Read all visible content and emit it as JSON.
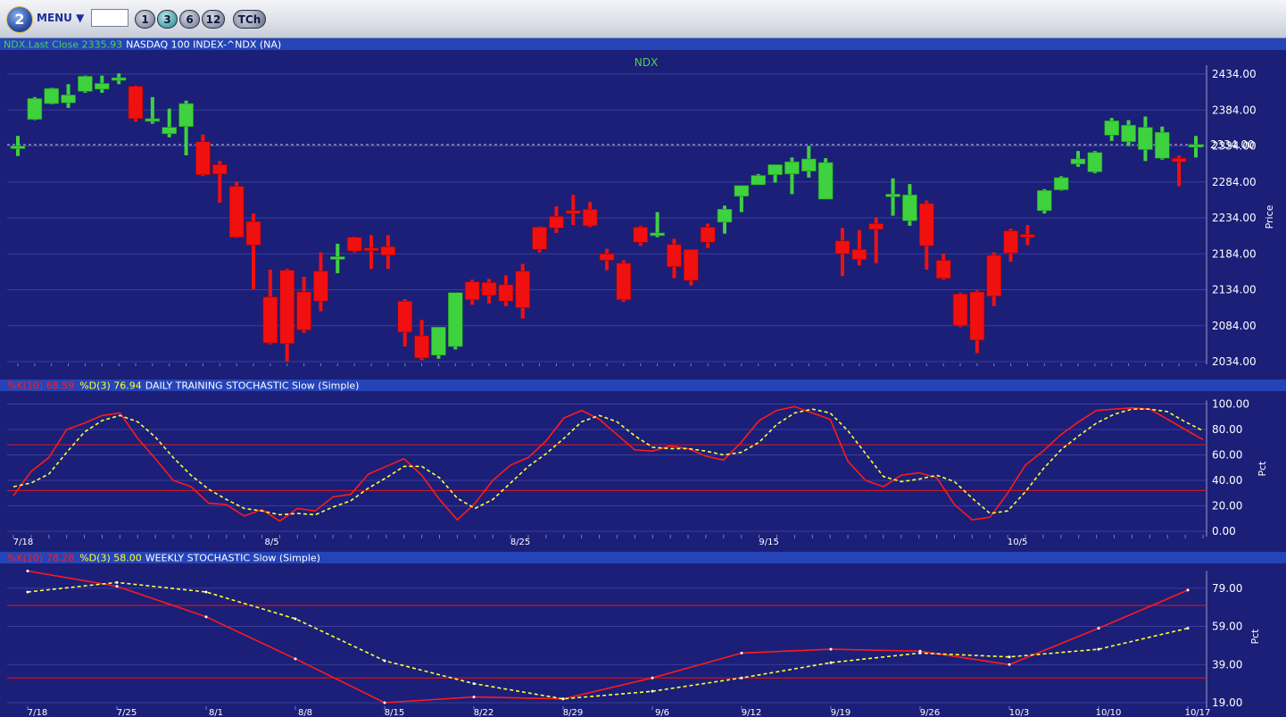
{
  "toolbar": {
    "menu_label": "MENU ▼",
    "symbol_input_value": "",
    "buttons": [
      "1",
      "3",
      "6",
      "12",
      "TCh"
    ],
    "active_button": "3"
  },
  "colors": {
    "panel_bg": "#1b1f78",
    "header_bar": "#2544b8",
    "up_candle": "#3ed23e",
    "down_candle": "#f01010",
    "k_line": "#ff1a1a",
    "d_line": "#ffff33",
    "grid": "#3a3f9a"
  },
  "chart_data": [
    {
      "type": "candlestick",
      "panel": "price",
      "header_symbol": "NDX.Last Close",
      "header_value": "2335.93",
      "header_desc": "NASDAQ 100 INDEX-^NDX (NA)",
      "title": "NDX",
      "ylabel": "Price",
      "ylim": [
        2034,
        2469
      ],
      "yticks": [
        2034,
        2084,
        2134,
        2184,
        2234,
        2284,
        2334,
        2384,
        2434
      ],
      "ytick_labels": [
        "2034.00",
        "2084.00",
        "2134.00",
        "2184.00",
        "2234.00",
        "2284.00",
        "2334.00",
        "2384.00",
        "2434.00"
      ],
      "last_close": 2335.93,
      "candles": [
        {
          "o": 2332,
          "h": 2348,
          "l": 2320,
          "c": 2334
        },
        {
          "o": 2371,
          "h": 2402,
          "l": 2370,
          "c": 2400
        },
        {
          "o": 2393,
          "h": 2415,
          "l": 2392,
          "c": 2414
        },
        {
          "o": 2394,
          "h": 2420,
          "l": 2387,
          "c": 2405
        },
        {
          "o": 2410,
          "h": 2432,
          "l": 2408,
          "c": 2431
        },
        {
          "o": 2413,
          "h": 2432,
          "l": 2408,
          "c": 2421
        },
        {
          "o": 2427,
          "h": 2435,
          "l": 2420,
          "c": 2429
        },
        {
          "o": 2417,
          "h": 2418,
          "l": 2368,
          "c": 2372
        },
        {
          "o": 2371,
          "h": 2402,
          "l": 2365,
          "c": 2372
        },
        {
          "o": 2351,
          "h": 2386,
          "l": 2346,
          "c": 2360
        },
        {
          "o": 2361,
          "h": 2397,
          "l": 2321,
          "c": 2393
        },
        {
          "o": 2340,
          "h": 2350,
          "l": 2292,
          "c": 2294
        },
        {
          "o": 2308,
          "h": 2313,
          "l": 2255,
          "c": 2295
        },
        {
          "o": 2278,
          "h": 2284,
          "l": 2206,
          "c": 2207
        },
        {
          "o": 2229,
          "h": 2240,
          "l": 2135,
          "c": 2196
        },
        {
          "o": 2124,
          "h": 2162,
          "l": 2058,
          "c": 2060
        },
        {
          "o": 2161,
          "h": 2163,
          "l": 2034,
          "c": 2059
        },
        {
          "o": 2131,
          "h": 2152,
          "l": 2074,
          "c": 2078
        },
        {
          "o": 2160,
          "h": 2186,
          "l": 2104,
          "c": 2118
        },
        {
          "o": 2180,
          "h": 2198,
          "l": 2157,
          "c": 2180
        },
        {
          "o": 2207,
          "h": 2208,
          "l": 2186,
          "c": 2188
        },
        {
          "o": 2192,
          "h": 2210,
          "l": 2163,
          "c": 2191
        },
        {
          "o": 2194,
          "h": 2210,
          "l": 2163,
          "c": 2182
        },
        {
          "o": 2118,
          "h": 2121,
          "l": 2055,
          "c": 2075
        },
        {
          "o": 2070,
          "h": 2092,
          "l": 2036,
          "c": 2039
        },
        {
          "o": 2043,
          "h": 2080,
          "l": 2038,
          "c": 2082
        },
        {
          "o": 2055,
          "h": 2130,
          "l": 2051,
          "c": 2130
        },
        {
          "o": 2145,
          "h": 2148,
          "l": 2113,
          "c": 2120
        },
        {
          "o": 2144,
          "h": 2149,
          "l": 2115,
          "c": 2126
        },
        {
          "o": 2141,
          "h": 2154,
          "l": 2111,
          "c": 2118
        },
        {
          "o": 2160,
          "h": 2170,
          "l": 2094,
          "c": 2109
        },
        {
          "o": 2221,
          "h": 2222,
          "l": 2186,
          "c": 2190
        },
        {
          "o": 2236,
          "h": 2250,
          "l": 2213,
          "c": 2220
        },
        {
          "o": 2244,
          "h": 2266,
          "l": 2224,
          "c": 2240
        },
        {
          "o": 2246,
          "h": 2256,
          "l": 2221,
          "c": 2223
        },
        {
          "o": 2184,
          "h": 2191,
          "l": 2161,
          "c": 2175
        },
        {
          "o": 2171,
          "h": 2175,
          "l": 2117,
          "c": 2120
        },
        {
          "o": 2221,
          "h": 2223,
          "l": 2195,
          "c": 2200
        },
        {
          "o": 2211,
          "h": 2242,
          "l": 2207,
          "c": 2213
        },
        {
          "o": 2197,
          "h": 2205,
          "l": 2150,
          "c": 2166
        },
        {
          "o": 2190,
          "h": 2190,
          "l": 2140,
          "c": 2147
        },
        {
          "o": 2221,
          "h": 2226,
          "l": 2192,
          "c": 2200
        },
        {
          "o": 2228,
          "h": 2251,
          "l": 2212,
          "c": 2246
        },
        {
          "o": 2264,
          "h": 2276,
          "l": 2242,
          "c": 2279
        },
        {
          "o": 2280,
          "h": 2295,
          "l": 2280,
          "c": 2293
        },
        {
          "o": 2294,
          "h": 2307,
          "l": 2283,
          "c": 2308
        },
        {
          "o": 2295,
          "h": 2318,
          "l": 2267,
          "c": 2312
        },
        {
          "o": 2299,
          "h": 2334,
          "l": 2290,
          "c": 2316
        },
        {
          "o": 2260,
          "h": 2317,
          "l": 2260,
          "c": 2311
        },
        {
          "o": 2202,
          "h": 2220,
          "l": 2153,
          "c": 2184
        },
        {
          "o": 2190,
          "h": 2217,
          "l": 2168,
          "c": 2176
        },
        {
          "o": 2226,
          "h": 2235,
          "l": 2171,
          "c": 2218
        },
        {
          "o": 2264,
          "h": 2289,
          "l": 2237,
          "c": 2267
        },
        {
          "o": 2230,
          "h": 2281,
          "l": 2223,
          "c": 2266
        },
        {
          "o": 2254,
          "h": 2258,
          "l": 2162,
          "c": 2195
        },
        {
          "o": 2175,
          "h": 2184,
          "l": 2148,
          "c": 2150
        },
        {
          "o": 2128,
          "h": 2130,
          "l": 2082,
          "c": 2084
        },
        {
          "o": 2131,
          "h": 2133,
          "l": 2046,
          "c": 2064
        },
        {
          "o": 2182,
          "h": 2186,
          "l": 2111,
          "c": 2125
        },
        {
          "o": 2216,
          "h": 2219,
          "l": 2173,
          "c": 2185
        },
        {
          "o": 2211,
          "h": 2224,
          "l": 2196,
          "c": 2207
        },
        {
          "o": 2244,
          "h": 2274,
          "l": 2240,
          "c": 2272
        },
        {
          "o": 2273,
          "h": 2292,
          "l": 2272,
          "c": 2290
        },
        {
          "o": 2309,
          "h": 2327,
          "l": 2305,
          "c": 2316
        },
        {
          "o": 2298,
          "h": 2327,
          "l": 2296,
          "c": 2325
        },
        {
          "o": 2349,
          "h": 2373,
          "l": 2341,
          "c": 2369
        },
        {
          "o": 2340,
          "h": 2370,
          "l": 2334,
          "c": 2363
        },
        {
          "o": 2329,
          "h": 2375,
          "l": 2313,
          "c": 2360
        },
        {
          "o": 2317,
          "h": 2361,
          "l": 2315,
          "c": 2353
        },
        {
          "o": 2317,
          "h": 2321,
          "l": 2278,
          "c": 2312
        },
        {
          "o": 2333,
          "h": 2348,
          "l": 2318,
          "c": 2336
        }
      ]
    },
    {
      "type": "line",
      "panel": "daily_stochastic",
      "header_k": "%K(10) 68.59",
      "header_d": "%D(3) 76.94",
      "header_title": "DAILY TRAINING STOCHASTIC Slow (Simple)",
      "ylabel": "Pct",
      "ylim": [
        0,
        100
      ],
      "yticks": [
        0,
        20,
        40,
        60,
        80,
        100
      ],
      "ytick_labels": [
        "0.00",
        "20.00",
        "40.00",
        "60.00",
        "80.00",
        "100.00"
      ],
      "ref_lines": [
        68,
        32
      ],
      "xtick_labels": [
        "7/18",
        "8/5",
        "8/25",
        "9/15",
        "10/5"
      ],
      "xtick_index": [
        0,
        14,
        28,
        42,
        56
      ],
      "series": [
        {
          "key": "k",
          "values": [
            28,
            47,
            58,
            80,
            85,
            91,
            93,
            73,
            57,
            40,
            35,
            22,
            21,
            12,
            17,
            8,
            18,
            16,
            27,
            29,
            45,
            51,
            57,
            44,
            25,
            9,
            22,
            40,
            52,
            58,
            71,
            89,
            95,
            88,
            76,
            64,
            63,
            67,
            65,
            59,
            56,
            70,
            87,
            95,
            98,
            93,
            88,
            55,
            40,
            35,
            44,
            46,
            42,
            21,
            9,
            11,
            30,
            52,
            63,
            76,
            86,
            95,
            96,
            97,
            96,
            88,
            80,
            72
          ]
        },
        {
          "key": "d",
          "values": [
            35,
            38,
            45,
            62,
            78,
            87,
            91,
            86,
            74,
            58,
            44,
            33,
            25,
            18,
            16,
            13,
            14,
            13,
            19,
            24,
            34,
            42,
            51,
            51,
            42,
            26,
            18,
            25,
            38,
            51,
            61,
            73,
            86,
            91,
            86,
            75,
            66,
            65,
            65,
            63,
            60,
            62,
            70,
            84,
            93,
            96,
            93,
            79,
            61,
            43,
            39,
            41,
            44,
            39,
            26,
            14,
            16,
            31,
            49,
            64,
            75,
            85,
            92,
            96,
            96,
            94,
            86,
            79
          ]
        }
      ]
    },
    {
      "type": "line",
      "panel": "weekly_stochastic",
      "header_k": "%K(10) 78.28",
      "header_d": "%D(3) 58.00",
      "header_title": "WEEKLY STOCHASTIC Slow (Simple)",
      "ylabel": "Pct",
      "ylim": [
        19,
        89
      ],
      "yticks": [
        19,
        39,
        59,
        79
      ],
      "ytick_labels": [
        "19.00",
        "39.00",
        "59.00",
        "79.00"
      ],
      "ref_lines": [
        70,
        32
      ],
      "categories": [
        "7/18",
        "7/25",
        "8/1",
        "8/8",
        "8/15",
        "8/22",
        "8/29",
        "9/6",
        "9/12",
        "9/19",
        "9/26",
        "10/3",
        "10/10",
        "10/17"
      ],
      "series": [
        {
          "key": "k",
          "values": [
            88,
            80,
            64,
            42,
            19,
            22,
            21,
            32,
            45,
            47,
            46,
            39,
            58,
            78
          ]
        },
        {
          "key": "d",
          "values": [
            77,
            82,
            77,
            63,
            41,
            29,
            21,
            25,
            32,
            40,
            45,
            43,
            47,
            58
          ]
        }
      ]
    }
  ]
}
